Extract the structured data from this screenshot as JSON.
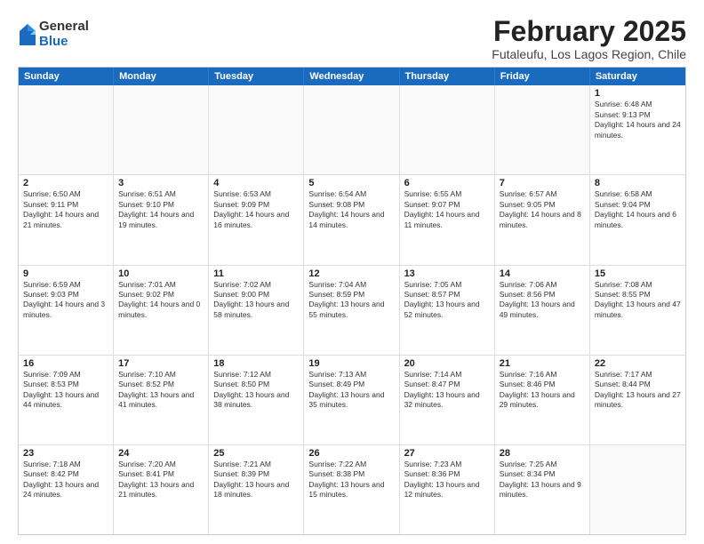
{
  "logo": {
    "general": "General",
    "blue": "Blue"
  },
  "title": "February 2025",
  "subtitle": "Futaleufu, Los Lagos Region, Chile",
  "header_days": [
    "Sunday",
    "Monday",
    "Tuesday",
    "Wednesday",
    "Thursday",
    "Friday",
    "Saturday"
  ],
  "weeks": [
    [
      {
        "day": "",
        "text": ""
      },
      {
        "day": "",
        "text": ""
      },
      {
        "day": "",
        "text": ""
      },
      {
        "day": "",
        "text": ""
      },
      {
        "day": "",
        "text": ""
      },
      {
        "day": "",
        "text": ""
      },
      {
        "day": "1",
        "text": "Sunrise: 6:48 AM\nSunset: 9:13 PM\nDaylight: 14 hours and 24 minutes."
      }
    ],
    [
      {
        "day": "2",
        "text": "Sunrise: 6:50 AM\nSunset: 9:11 PM\nDaylight: 14 hours and 21 minutes."
      },
      {
        "day": "3",
        "text": "Sunrise: 6:51 AM\nSunset: 9:10 PM\nDaylight: 14 hours and 19 minutes."
      },
      {
        "day": "4",
        "text": "Sunrise: 6:53 AM\nSunset: 9:09 PM\nDaylight: 14 hours and 16 minutes."
      },
      {
        "day": "5",
        "text": "Sunrise: 6:54 AM\nSunset: 9:08 PM\nDaylight: 14 hours and 14 minutes."
      },
      {
        "day": "6",
        "text": "Sunrise: 6:55 AM\nSunset: 9:07 PM\nDaylight: 14 hours and 11 minutes."
      },
      {
        "day": "7",
        "text": "Sunrise: 6:57 AM\nSunset: 9:05 PM\nDaylight: 14 hours and 8 minutes."
      },
      {
        "day": "8",
        "text": "Sunrise: 6:58 AM\nSunset: 9:04 PM\nDaylight: 14 hours and 6 minutes."
      }
    ],
    [
      {
        "day": "9",
        "text": "Sunrise: 6:59 AM\nSunset: 9:03 PM\nDaylight: 14 hours and 3 minutes."
      },
      {
        "day": "10",
        "text": "Sunrise: 7:01 AM\nSunset: 9:02 PM\nDaylight: 14 hours and 0 minutes."
      },
      {
        "day": "11",
        "text": "Sunrise: 7:02 AM\nSunset: 9:00 PM\nDaylight: 13 hours and 58 minutes."
      },
      {
        "day": "12",
        "text": "Sunrise: 7:04 AM\nSunset: 8:59 PM\nDaylight: 13 hours and 55 minutes."
      },
      {
        "day": "13",
        "text": "Sunrise: 7:05 AM\nSunset: 8:57 PM\nDaylight: 13 hours and 52 minutes."
      },
      {
        "day": "14",
        "text": "Sunrise: 7:06 AM\nSunset: 8:56 PM\nDaylight: 13 hours and 49 minutes."
      },
      {
        "day": "15",
        "text": "Sunrise: 7:08 AM\nSunset: 8:55 PM\nDaylight: 13 hours and 47 minutes."
      }
    ],
    [
      {
        "day": "16",
        "text": "Sunrise: 7:09 AM\nSunset: 8:53 PM\nDaylight: 13 hours and 44 minutes."
      },
      {
        "day": "17",
        "text": "Sunrise: 7:10 AM\nSunset: 8:52 PM\nDaylight: 13 hours and 41 minutes."
      },
      {
        "day": "18",
        "text": "Sunrise: 7:12 AM\nSunset: 8:50 PM\nDaylight: 13 hours and 38 minutes."
      },
      {
        "day": "19",
        "text": "Sunrise: 7:13 AM\nSunset: 8:49 PM\nDaylight: 13 hours and 35 minutes."
      },
      {
        "day": "20",
        "text": "Sunrise: 7:14 AM\nSunset: 8:47 PM\nDaylight: 13 hours and 32 minutes."
      },
      {
        "day": "21",
        "text": "Sunrise: 7:16 AM\nSunset: 8:46 PM\nDaylight: 13 hours and 29 minutes."
      },
      {
        "day": "22",
        "text": "Sunrise: 7:17 AM\nSunset: 8:44 PM\nDaylight: 13 hours and 27 minutes."
      }
    ],
    [
      {
        "day": "23",
        "text": "Sunrise: 7:18 AM\nSunset: 8:42 PM\nDaylight: 13 hours and 24 minutes."
      },
      {
        "day": "24",
        "text": "Sunrise: 7:20 AM\nSunset: 8:41 PM\nDaylight: 13 hours and 21 minutes."
      },
      {
        "day": "25",
        "text": "Sunrise: 7:21 AM\nSunset: 8:39 PM\nDaylight: 13 hours and 18 minutes."
      },
      {
        "day": "26",
        "text": "Sunrise: 7:22 AM\nSunset: 8:38 PM\nDaylight: 13 hours and 15 minutes."
      },
      {
        "day": "27",
        "text": "Sunrise: 7:23 AM\nSunset: 8:36 PM\nDaylight: 13 hours and 12 minutes."
      },
      {
        "day": "28",
        "text": "Sunrise: 7:25 AM\nSunset: 8:34 PM\nDaylight: 13 hours and 9 minutes."
      },
      {
        "day": "",
        "text": ""
      }
    ]
  ]
}
